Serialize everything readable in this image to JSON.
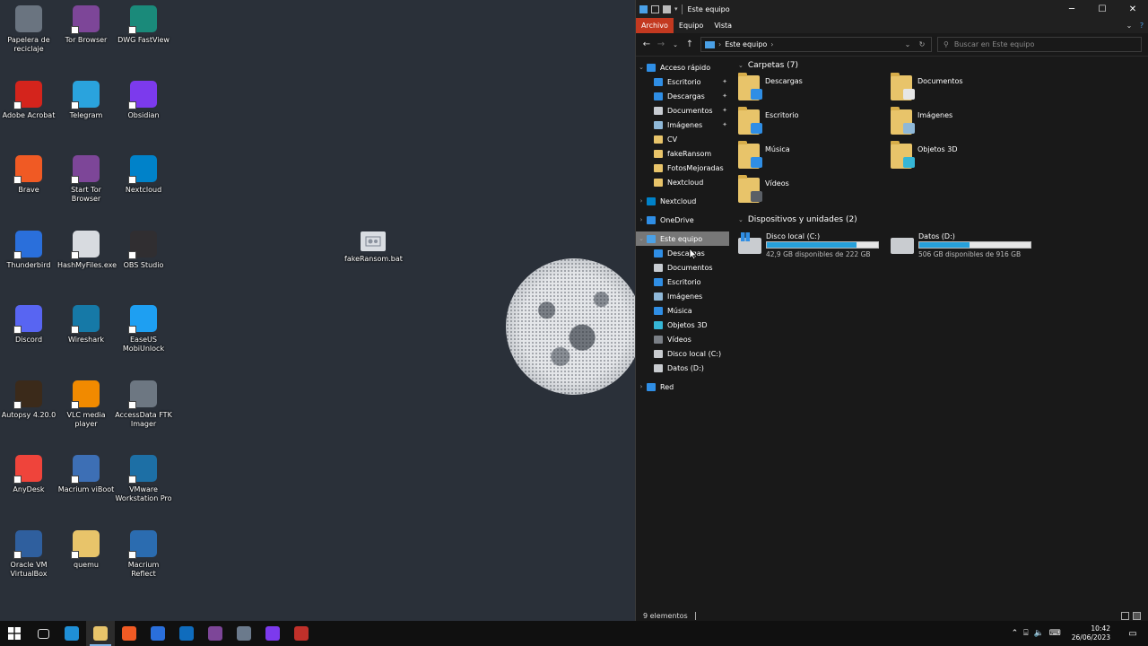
{
  "desktop": {
    "icons": [
      {
        "label": "Papelera de reciclaje",
        "icon": "recycle-bin-icon",
        "color": "#6a7480"
      },
      {
        "label": "Tor Browser",
        "icon": "tor-browser-icon",
        "color": "#7d4698"
      },
      {
        "label": "DWG FastView",
        "icon": "dwg-fastview-icon",
        "color": "#1a8a7a"
      },
      {
        "label": "Adobe Acrobat",
        "icon": "adobe-acrobat-icon",
        "color": "#d4241c"
      },
      {
        "label": "Telegram",
        "icon": "telegram-icon",
        "color": "#2aa3dd"
      },
      {
        "label": "Obsidian",
        "icon": "obsidian-icon",
        "color": "#7c3aed"
      },
      {
        "label": "Brave",
        "icon": "brave-icon",
        "color": "#f05a24"
      },
      {
        "label": "Start Tor Browser",
        "icon": "start-tor-icon",
        "color": "#7d4698"
      },
      {
        "label": "Nextcloud",
        "icon": "nextcloud-icon",
        "color": "#0082c9"
      },
      {
        "label": "Thunderbird",
        "icon": "thunderbird-icon",
        "color": "#2a6fdb"
      },
      {
        "label": "HashMyFiles.exe",
        "icon": "file-icon",
        "color": "#d8dbe0"
      },
      {
        "label": "OBS Studio",
        "icon": "obs-icon",
        "color": "#302e31"
      },
      {
        "label": "Discord",
        "icon": "discord-icon",
        "color": "#5865f2"
      },
      {
        "label": "Wireshark",
        "icon": "wireshark-icon",
        "color": "#1679a7"
      },
      {
        "label": "EaseUS MobiUnlock",
        "icon": "easeus-icon",
        "color": "#1e9ff2"
      },
      {
        "label": "Autopsy 4.20.0",
        "icon": "autopsy-icon",
        "color": "#3b2a1a"
      },
      {
        "label": "VLC media player",
        "icon": "vlc-icon",
        "color": "#f18a00"
      },
      {
        "label": "AccessData FTK Imager",
        "icon": "ftk-imager-icon",
        "color": "#6d7782"
      },
      {
        "label": "AnyDesk",
        "icon": "anydesk-icon",
        "color": "#ef443b"
      },
      {
        "label": "Macrium viBoot",
        "icon": "viboot-icon",
        "color": "#3d6fb5"
      },
      {
        "label": "VMware Workstation Pro",
        "icon": "vmware-icon",
        "color": "#1d6fa5"
      },
      {
        "label": "Oracle VM VirtualBox",
        "icon": "virtualbox-icon",
        "color": "#2f5f9e"
      },
      {
        "label": "quemu",
        "icon": "folder-icon",
        "color": "#e8c46a"
      },
      {
        "label": "Macrium Reflect",
        "icon": "macrium-reflect-icon",
        "color": "#2b6cb0"
      }
    ],
    "loose_file": {
      "label": "fakeRansom.bat",
      "icon": "batch-file-icon"
    }
  },
  "explorer": {
    "title": "Este equipo",
    "ribbon_tabs": [
      "Archivo",
      "Equipo",
      "Vista"
    ],
    "address": "Este equipo",
    "search_placeholder": "Buscar en Este equipo",
    "nav": [
      {
        "label": "Acceso rápido",
        "level": 0,
        "expanded": true,
        "color": "#2f8ee5",
        "pin": false
      },
      {
        "label": "Escritorio",
        "level": 1,
        "color": "#2f8ee5",
        "pin": true
      },
      {
        "label": "Descargas",
        "level": 1,
        "color": "#2f8ee5",
        "pin": true
      },
      {
        "label": "Documentos",
        "level": 1,
        "color": "#c8ccd2",
        "pin": true
      },
      {
        "label": "Imágenes",
        "level": 1,
        "color": "#8fb8d8",
        "pin": true
      },
      {
        "label": "CV",
        "level": 1,
        "color": "#e8c46a",
        "pin": false
      },
      {
        "label": "fakeRansom",
        "level": 1,
        "color": "#e8c46a",
        "pin": false
      },
      {
        "label": "FotosMejoradas",
        "level": 1,
        "color": "#e8c46a",
        "pin": false
      },
      {
        "label": "Nextcloud",
        "level": 1,
        "color": "#e8c46a",
        "pin": false
      },
      {
        "label": "Nextcloud",
        "level": 0,
        "expanded": false,
        "color": "#0082c9",
        "pin": false
      },
      {
        "label": "OneDrive",
        "level": 0,
        "expanded": false,
        "color": "#2f8ee5",
        "pin": false
      },
      {
        "label": "Este equipo",
        "level": 0,
        "expanded": true,
        "color": "#4aa0e6",
        "pin": false,
        "selected": true
      },
      {
        "label": "Descargas",
        "level": 1,
        "color": "#2f8ee5",
        "pin": false
      },
      {
        "label": "Documentos",
        "level": 1,
        "color": "#c8ccd2",
        "pin": false
      },
      {
        "label": "Escritorio",
        "level": 1,
        "color": "#2f8ee5",
        "pin": false
      },
      {
        "label": "Imágenes",
        "level": 1,
        "color": "#8fb8d8",
        "pin": false
      },
      {
        "label": "Música",
        "level": 1,
        "color": "#2f8ee5",
        "pin": false
      },
      {
        "label": "Objetos 3D",
        "level": 1,
        "color": "#35b6d6",
        "pin": false
      },
      {
        "label": "Vídeos",
        "level": 1,
        "color": "#7a7f86",
        "pin": false
      },
      {
        "label": "Disco local (C:)",
        "level": 1,
        "color": "#c9ccd0",
        "pin": false
      },
      {
        "label": "Datos (D:)",
        "level": 1,
        "color": "#c9ccd0",
        "pin": false
      },
      {
        "label": "Red",
        "level": 0,
        "expanded": false,
        "color": "#2f8ee5",
        "pin": false
      }
    ],
    "folders_header": "Carpetas (7)",
    "folders": [
      {
        "name": "Descargas",
        "badge": "#2f8ee5"
      },
      {
        "name": "Documentos",
        "badge": "#e6e6e6"
      },
      {
        "name": "Escritorio",
        "badge": "#2f8ee5"
      },
      {
        "name": "Imágenes",
        "badge": "#8fb8d8"
      },
      {
        "name": "Música",
        "badge": "#2f8ee5"
      },
      {
        "name": "Objetos 3D",
        "badge": "#35b6d6"
      },
      {
        "name": "Vídeos",
        "badge": "#5a5f66"
      }
    ],
    "drives_header": "Dispositivos y unidades (2)",
    "drives": [
      {
        "name": "Disco local (C:)",
        "free_text": "42,9 GB disponibles de 222 GB",
        "used_fraction": 0.81,
        "system": true
      },
      {
        "name": "Datos (D:)",
        "free_text": "506 GB disponibles de 916 GB",
        "used_fraction": 0.45,
        "system": false
      }
    ],
    "status": "9 elementos"
  },
  "taskbar": {
    "apps": [
      {
        "icon": "task-view-icon",
        "color": "#101010",
        "active": false
      },
      {
        "icon": "edge-icon",
        "color": "#1f8fd6",
        "active": false
      },
      {
        "icon": "file-explorer-icon",
        "color": "#e8c46a",
        "active": true
      },
      {
        "icon": "brave-icon",
        "color": "#f05a24",
        "active": false
      },
      {
        "icon": "thunderbird-icon",
        "color": "#2a6fdb",
        "active": false
      },
      {
        "icon": "outlook-icon",
        "color": "#0f6cbd",
        "active": false
      },
      {
        "icon": "tor-browser-icon",
        "color": "#7d4698",
        "active": false
      },
      {
        "icon": "virtualbox-icon",
        "color": "#6b7a8c",
        "active": false
      },
      {
        "icon": "obsidian-icon",
        "color": "#7c3aed",
        "active": false
      },
      {
        "icon": "macrium-reflect-icon",
        "color": "#c0302a",
        "active": false
      }
    ],
    "time": "10:42",
    "date": "26/06/2023"
  }
}
